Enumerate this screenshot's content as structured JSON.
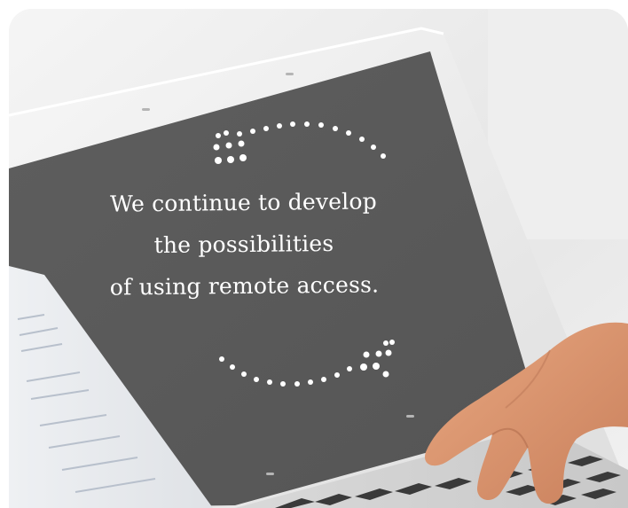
{
  "message": {
    "line1": "We continue to develop",
    "line2": "the possibilities",
    "line3": "of using remote access."
  },
  "colors": {
    "screen": "#5a5a5a",
    "text": "#ffffff",
    "laptop_body": "#ececec",
    "skin": "#dd9670"
  }
}
